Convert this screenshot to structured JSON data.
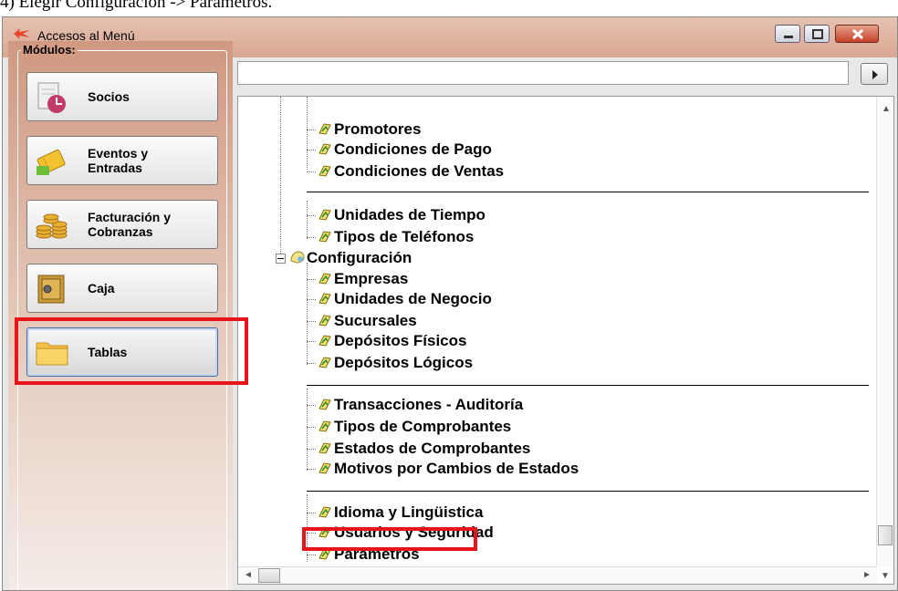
{
  "caption": "4) Elegir Configuración -> Parámetros.",
  "window": {
    "title": "Accesos al Menú"
  },
  "modules": {
    "label": "Módulos:",
    "buttons": [
      {
        "label": "Socios"
      },
      {
        "label_line1": "Eventos y",
        "label_line2": "Entradas"
      },
      {
        "label_line1": "Facturación y",
        "label_line2": "Cobranzas"
      },
      {
        "label": "Caja"
      },
      {
        "label": "Tablas",
        "active": true
      }
    ]
  },
  "path_bar": {
    "value": ""
  },
  "tree": {
    "items": [
      "Promotores",
      "Condiciones de Pago",
      "Condiciones de Ventas",
      "Unidades de Tiempo",
      "Tipos de Teléfonos",
      "Configuración",
      "Empresas",
      "Unidades de Negocio",
      "Sucursales",
      "Depósitos Físicos",
      "Depósitos Lógicos",
      "Transacciones - Auditoría",
      "Tipos de Comprobantes",
      "Estados de Comprobantes",
      "Motivos por Cambios de Estados",
      "Idioma y Lingüistica",
      "Usuarios y Seguridad",
      "Parámetros"
    ]
  },
  "highlight_color": "#e8141c",
  "icons": [
    "app-icon",
    "minimize-icon",
    "maximize-icon",
    "close-icon",
    "go-arrow-icon",
    "folder-icon",
    "safe-icon",
    "coins-icon",
    "ticket-icon",
    "calendar-icon",
    "tree-item-icon",
    "configuration-icon"
  ]
}
